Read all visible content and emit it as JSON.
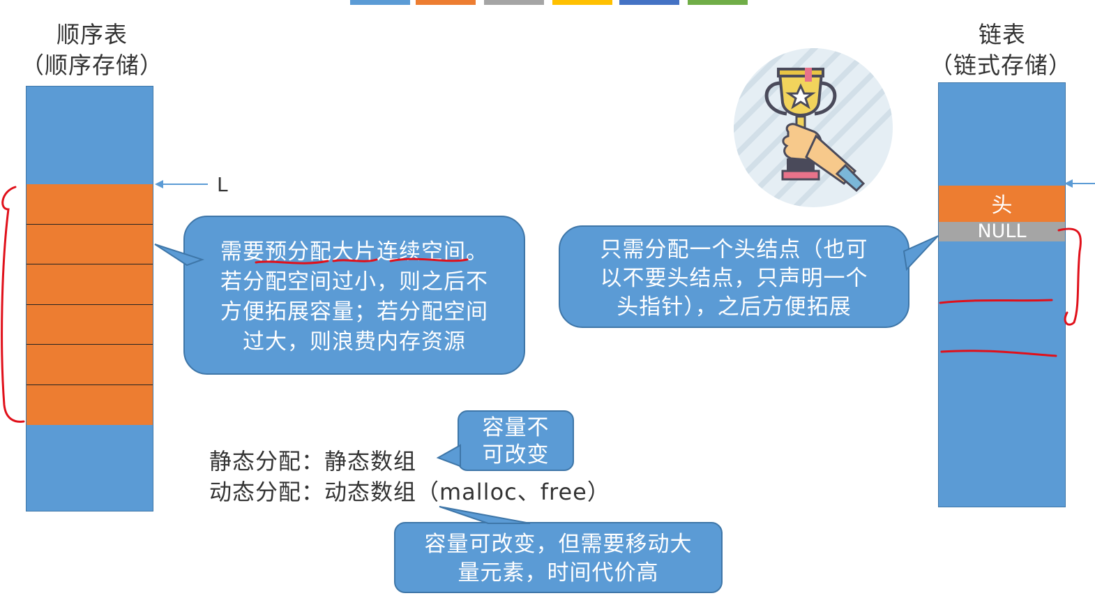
{
  "left": {
    "title": "顺序表",
    "subtitle": "（顺序存储）",
    "pointer_label": "L"
  },
  "right": {
    "title": "链表",
    "subtitle": "（链式存储）",
    "head_label": "头",
    "null_label": "NULL"
  },
  "bubbles": {
    "seq_line1": "需要预分配大片连续空间。",
    "seq_line2": "若分配空间过小，则之后不",
    "seq_line3": "方便拓展容量；若分配空间",
    "seq_line4": "过大，则浪费内存资源",
    "link_line1": "只需分配一个头结点（也可",
    "link_line2": "以不要头结点，只声明一个",
    "link_line3": "头指针），之后方便拓展",
    "fixed_line1": "容量不",
    "fixed_line2": "可改变",
    "dynamic_line1": "容量可改变，但需要移动大",
    "dynamic_line2": "量元素，时间代价高"
  },
  "allocation": {
    "static_line": "静态分配：静态数组",
    "dynamic_line": "动态分配：动态数组（malloc、free）"
  },
  "icons": {
    "trophy": "trophy-in-hand-icon"
  },
  "colors": {
    "block_blue": "#5b9bd5",
    "block_orange": "#ed7d31",
    "null_gray": "#a5a5a5",
    "annotation_red": "#e0101a",
    "top_bar": [
      "#5b9bd5",
      "#ed7d31",
      "#a5a5a5",
      "#ffc000",
      "#4472c4",
      "#70ad47"
    ]
  }
}
